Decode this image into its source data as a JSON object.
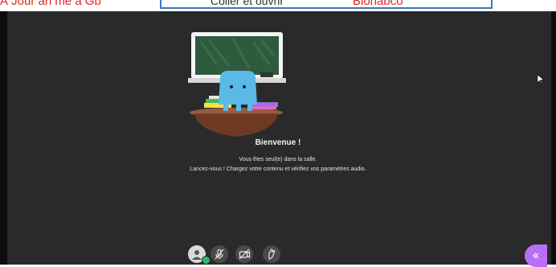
{
  "top_strip": {
    "left_text": "À Jour an mé a Gb",
    "middle_text": "Coller et ouvrir",
    "right_text": "Blonabco"
  },
  "welcome": {
    "title": "Bienvenue !",
    "line1": "Vous êtes seul(e) dans la salle.",
    "line2": "Lancez-vous ! Chargez votre contenu et vérifiez vos paramètres audio."
  },
  "toolbar": {
    "buttons": [
      {
        "name": "avatar",
        "icon": "user-avatar-icon",
        "status": "online"
      },
      {
        "name": "microphone",
        "icon": "microphone-off-icon"
      },
      {
        "name": "camera",
        "icon": "camera-off-icon"
      },
      {
        "name": "hand",
        "icon": "raise-hand-icon"
      }
    ]
  },
  "collaborate_panel": {
    "icon": "chevron-double-left-icon"
  },
  "colors": {
    "stage_bg": "#2a2a2a",
    "accent_purple": "#b86ef5",
    "status_green": "#2bb673"
  }
}
